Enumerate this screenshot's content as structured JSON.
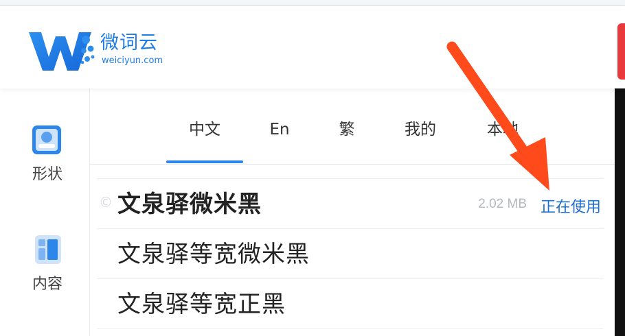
{
  "logo": {
    "name": "微词云",
    "domain": "weiciyun.com",
    "brand_color": "#1f7de8"
  },
  "sidebar": {
    "items": [
      {
        "label": "形状",
        "icon": "shape-icon"
      },
      {
        "label": "内容",
        "icon": "content-layout-icon"
      }
    ]
  },
  "tabs": [
    {
      "label": "中文",
      "active": true
    },
    {
      "label": "En"
    },
    {
      "label": "繁"
    },
    {
      "label": "我的"
    },
    {
      "label": "本地"
    }
  ],
  "fonts": [
    {
      "name": "文泉驿微米黑",
      "mark": "©",
      "size": "2.02 MB",
      "status": "正在使用",
      "active": true
    },
    {
      "name": "文泉驿等宽微米黑"
    },
    {
      "name": "文泉驿等宽正黑"
    }
  ],
  "colors": {
    "accent": "#2d86ea",
    "status_text": "#1e6fd0",
    "annotation_arrow": "#ff4a1c"
  }
}
